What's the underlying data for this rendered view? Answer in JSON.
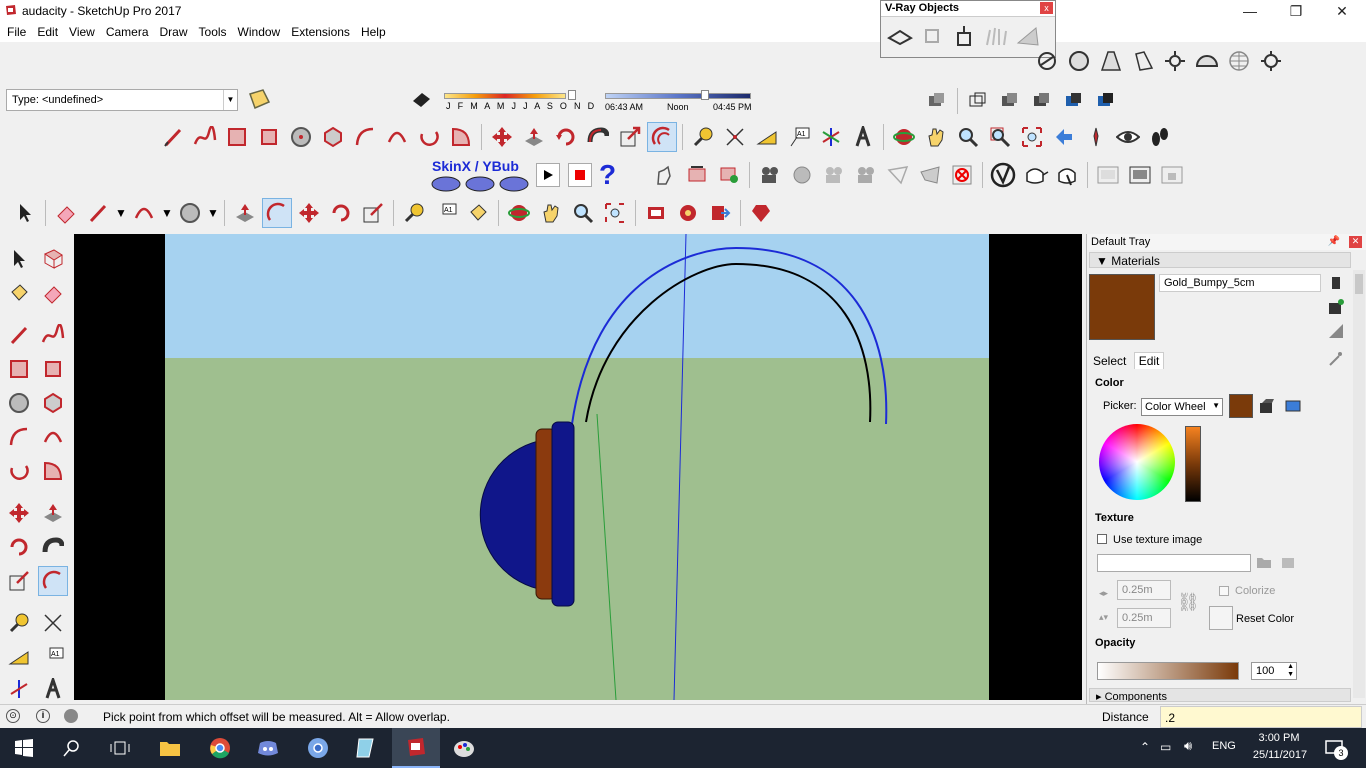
{
  "window": {
    "title": "audacity - SketchUp Pro 2017",
    "minimize": "—",
    "maximize": "❐",
    "close": "✕"
  },
  "menu": [
    "File",
    "Edit",
    "View",
    "Camera",
    "Draw",
    "Tools",
    "Window",
    "Extensions",
    "Help"
  ],
  "type_box": {
    "value": "Type: <undefined>"
  },
  "shadow": {
    "months": "J F M A M J J A S O N D",
    "time_start": "06:43 AM",
    "time_mid": "Noon",
    "time_end": "04:45 PM"
  },
  "plugin": {
    "label": "SkinX / YBub"
  },
  "vray": {
    "title": "V-Ray Objects",
    "close": "x"
  },
  "tray": {
    "title": "Default Tray",
    "materials_section": "Materials",
    "material_name": "Gold_Bumpy_5cm",
    "material_color": "#7a3a0a",
    "tabs": {
      "select": "Select",
      "edit": "Edit"
    },
    "color_heading": "Color",
    "picker_label": "Picker:",
    "picker_value": "Color Wheel",
    "texture_heading": "Texture",
    "use_texture": "Use texture image",
    "width": "0.25m",
    "height": "0.25m",
    "colorize": "Colorize",
    "reset_color": "Reset Color",
    "opacity_heading": "Opacity",
    "opacity_value": "100",
    "components_section": "Components"
  },
  "status": {
    "message": "Pick point from which offset will be measured. Alt = Allow overlap.",
    "measure_label": "Distance",
    "measure_value": ".2"
  },
  "taskbar": {
    "lang": "ENG",
    "time": "3:00 PM",
    "date": "25/11/2017",
    "notifications": "3"
  },
  "colors": {
    "sky": "#a6d2f0",
    "ground": "#9fbf8f",
    "dome": "#10168a",
    "ring": "#8b3a0e",
    "arc_blue": "#1c2bd6",
    "accent": "#c1272d"
  }
}
